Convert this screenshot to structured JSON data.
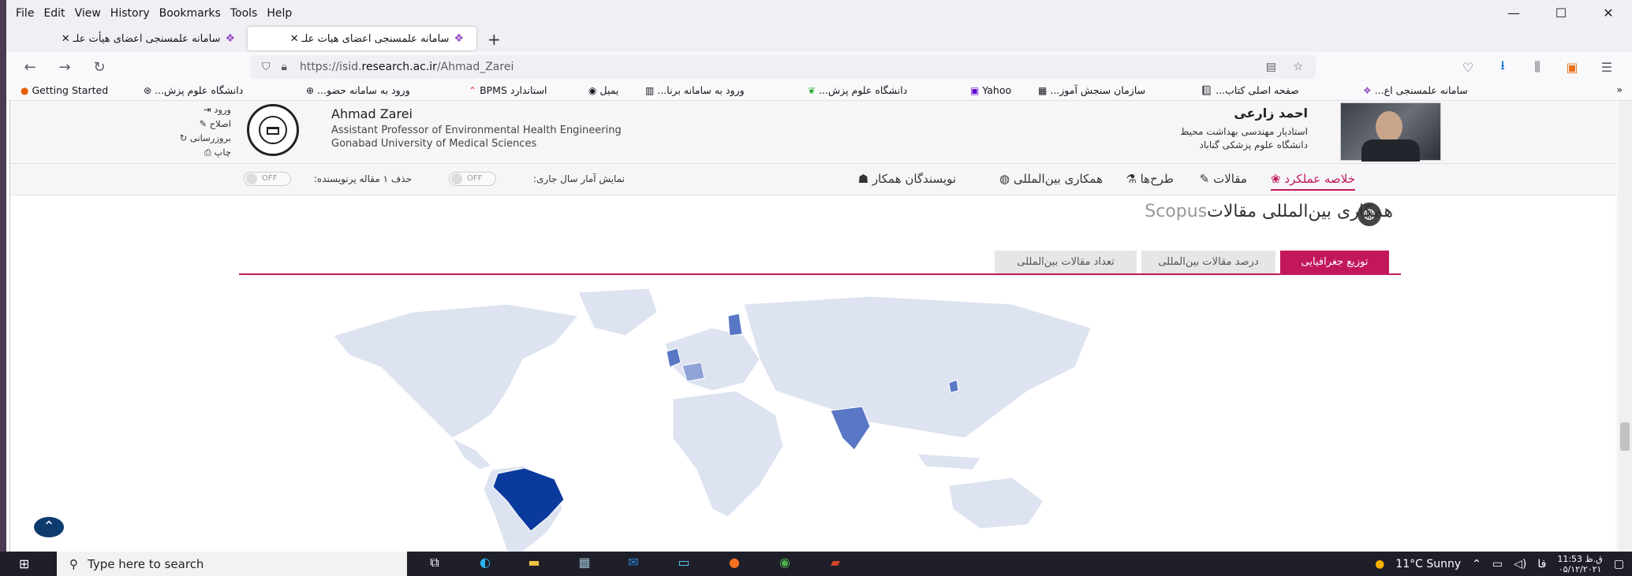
{
  "menu": {
    "file": "File",
    "edit": "Edit",
    "view": "View",
    "history": "History",
    "bookmarks": "Bookmarks",
    "tools": "Tools",
    "help": "Help"
  },
  "tabs": [
    {
      "label": "سامانه علمسنجی اعضای هیأت علـ"
    },
    {
      "label": "سامانه علمسنجی اعضای هیات علـ"
    }
  ],
  "url": {
    "prefix": "https://isid.",
    "host": "research.ac.ir",
    "path": "/Ahmad_Zarei"
  },
  "bookmarks": [
    "Getting Started",
    "دانشگاه علوم پزش...",
    "ورود به سامانه حضو...",
    "استاندارد BPMS",
    "یمیل",
    "ورود به سامانه برنا...",
    "دانشگاه علوم پزش...",
    "Yahoo",
    "سازمان سنجش آموز...",
    "صفحه اصلی کتاب...",
    "سامانه علمسنجی اع..."
  ],
  "profile": {
    "fa_name": "احمد زارعی",
    "fa_title": "استادیار مهندسی بهداشت محیط",
    "fa_univ": "دانشگاه علوم پزشکی گناباد",
    "en_name": "Ahmad Zarei",
    "en_title": "Assistant Professor of Environmental Health Engineering",
    "en_univ": "Gonabad University of Medical Sciences"
  },
  "side_links": [
    "ورود",
    "اصلاح",
    "بروزرسانی",
    "چاپ"
  ],
  "page_nav": [
    "خلاصه عملکرد",
    "مقالات",
    "طرح‌ها",
    "همکاری بین‌المللی",
    "نویسندگان همکار"
  ],
  "toggles": [
    {
      "label": "نمایش آمار سال جاری:",
      "state": "OFF"
    },
    {
      "label": "حذف ۱ مقاله پرنویسنده:",
      "state": "OFF"
    }
  ],
  "section": {
    "title": "همکاری بین‌المللی مقالات",
    "source": "Scopus"
  },
  "chart_tabs": [
    "توزیع جغرافیایی",
    "درصد مقالات بین‌المللی",
    "تعداد مقالات بین‌المللی"
  ],
  "map_colors": {
    "base": "#dde3f0",
    "light": "#8fa3d6",
    "medium": "#5977c4",
    "dark": "#0b3a9e"
  },
  "taskbar": {
    "search_placeholder": "Type here to search",
    "weather": "11°C  Sunny",
    "lang": "فا",
    "time": "11:53 ق.ظ",
    "date": "۰۵/۱۲/۲۰۲۱"
  }
}
